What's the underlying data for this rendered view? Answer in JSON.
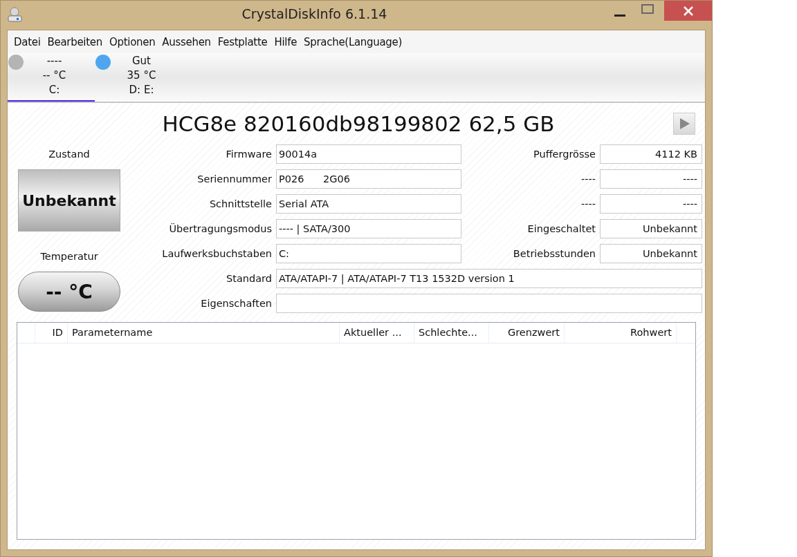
{
  "window": {
    "title": "CrystalDiskInfo 6.1.14"
  },
  "menu": [
    {
      "label": "Datei"
    },
    {
      "label": "Bearbeiten"
    },
    {
      "label": "Optionen"
    },
    {
      "label": "Aussehen"
    },
    {
      "label": "Festplatte"
    },
    {
      "label": "Hilfe"
    },
    {
      "label": "Sprache(Language)"
    }
  ],
  "drives": [
    {
      "status": "----",
      "temperature": "-- °C",
      "letters": "C:",
      "color": "#b4b4b4",
      "selected": true
    },
    {
      "status": "Gut",
      "temperature": "35 °C",
      "letters": "D: E:",
      "color": "#4ea6ee",
      "selected": false
    }
  ],
  "disk": {
    "model": "HCG8e 820160db98199802 62,5 GB",
    "health_label": "Zustand",
    "health": "Unbekannt",
    "temperature_label": "Temperatur",
    "temperature": "-- °C",
    "rows": [
      {
        "label": "Firmware",
        "value": "90014a",
        "side_label": "Puffergrösse",
        "side_value": "4112 KB"
      },
      {
        "label": "Seriennummer",
        "value": "P026      2G06",
        "side_label": "----",
        "side_value": "----"
      },
      {
        "label": "Schnittstelle",
        "value": "Serial ATA",
        "side_label": "----",
        "side_value": "----"
      },
      {
        "label": "Übertragungsmodus",
        "value": "---- | SATA/300",
        "side_label": "Eingeschaltet",
        "side_value": "Unbekannt"
      },
      {
        "label": "Laufwerksbuchstaben",
        "value": "C:",
        "side_label": "Betriebsstunden",
        "side_value": "Unbekannt"
      },
      {
        "label": "Standard",
        "value": "ATA/ATAPI-7 | ATA/ATAPI-7 T13 1532D version 1"
      },
      {
        "label": "Eigenschaften",
        "value": ""
      }
    ]
  },
  "table": {
    "columns": [
      "ID",
      "Parametername",
      "Aktueller ...",
      "Schlechte...",
      "Grenzwert",
      "Rohwert"
    ]
  }
}
